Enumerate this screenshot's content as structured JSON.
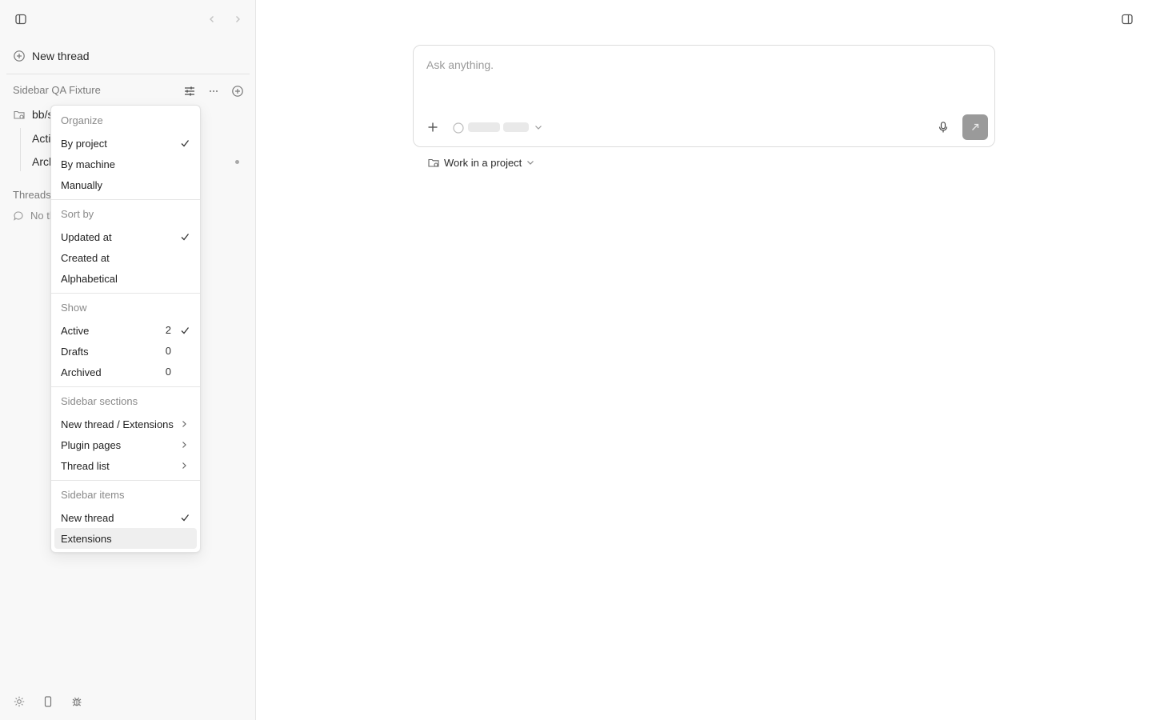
{
  "sidebar": {
    "new_thread_label": "New thread",
    "section_title": "Sidebar QA Fixture",
    "project": {
      "name": "bb/s"
    },
    "sub_items": [
      {
        "label": "Acti"
      },
      {
        "label": "Arch"
      }
    ],
    "threads_title": "Threads",
    "no_threads_label": "No th"
  },
  "menu": {
    "groups": [
      {
        "label": "Organize",
        "items": [
          {
            "label": "By project",
            "checked": true
          },
          {
            "label": "By machine"
          },
          {
            "label": "Manually"
          }
        ]
      },
      {
        "label": "Sort by",
        "items": [
          {
            "label": "Updated at",
            "checked": true
          },
          {
            "label": "Created at"
          },
          {
            "label": "Alphabetical"
          }
        ]
      },
      {
        "label": "Show",
        "items": [
          {
            "label": "Active",
            "count": "2",
            "checked": true
          },
          {
            "label": "Drafts",
            "count": "0"
          },
          {
            "label": "Archived",
            "count": "0"
          }
        ]
      },
      {
        "label": "Sidebar sections",
        "items": [
          {
            "label": "New thread / Extensions",
            "submenu": true
          },
          {
            "label": "Plugin pages",
            "submenu": true
          },
          {
            "label": "Thread list",
            "submenu": true
          }
        ]
      },
      {
        "label": "Sidebar items",
        "items": [
          {
            "label": "New thread",
            "checked": true
          },
          {
            "label": "Extensions",
            "highlighted": true
          }
        ]
      }
    ]
  },
  "composer": {
    "placeholder": "Ask anything."
  },
  "project_picker": {
    "label": "Work in a project"
  },
  "colors": {
    "sidebar_bg": "#f8f8f8",
    "send_button": "#9a9a9a",
    "menu_highlight": "#efefef"
  },
  "icons": {
    "top_left": "sidebar-toggle-icon",
    "top_right": "panel-toggle-icon",
    "nav_back": "chevron-left-icon",
    "nav_forward": "chevron-right-icon",
    "new_thread": "plus-circle-icon",
    "filter": "sliders-icon",
    "more": "ellipsis-icon",
    "add_project": "plus-circle-icon",
    "project": "folder-icon",
    "no_threads": "chat-bubble-icon",
    "footer": [
      "settings-icon",
      "device-icon",
      "bug-icon"
    ],
    "composer_add": "plus-icon",
    "mic": "microphone-icon",
    "send": "arrow-up-right-icon",
    "picker_folder": "folder-icon",
    "picker_chevron": "chevron-down-icon",
    "check": "check-icon",
    "submenu": "chevron-right-icon"
  }
}
